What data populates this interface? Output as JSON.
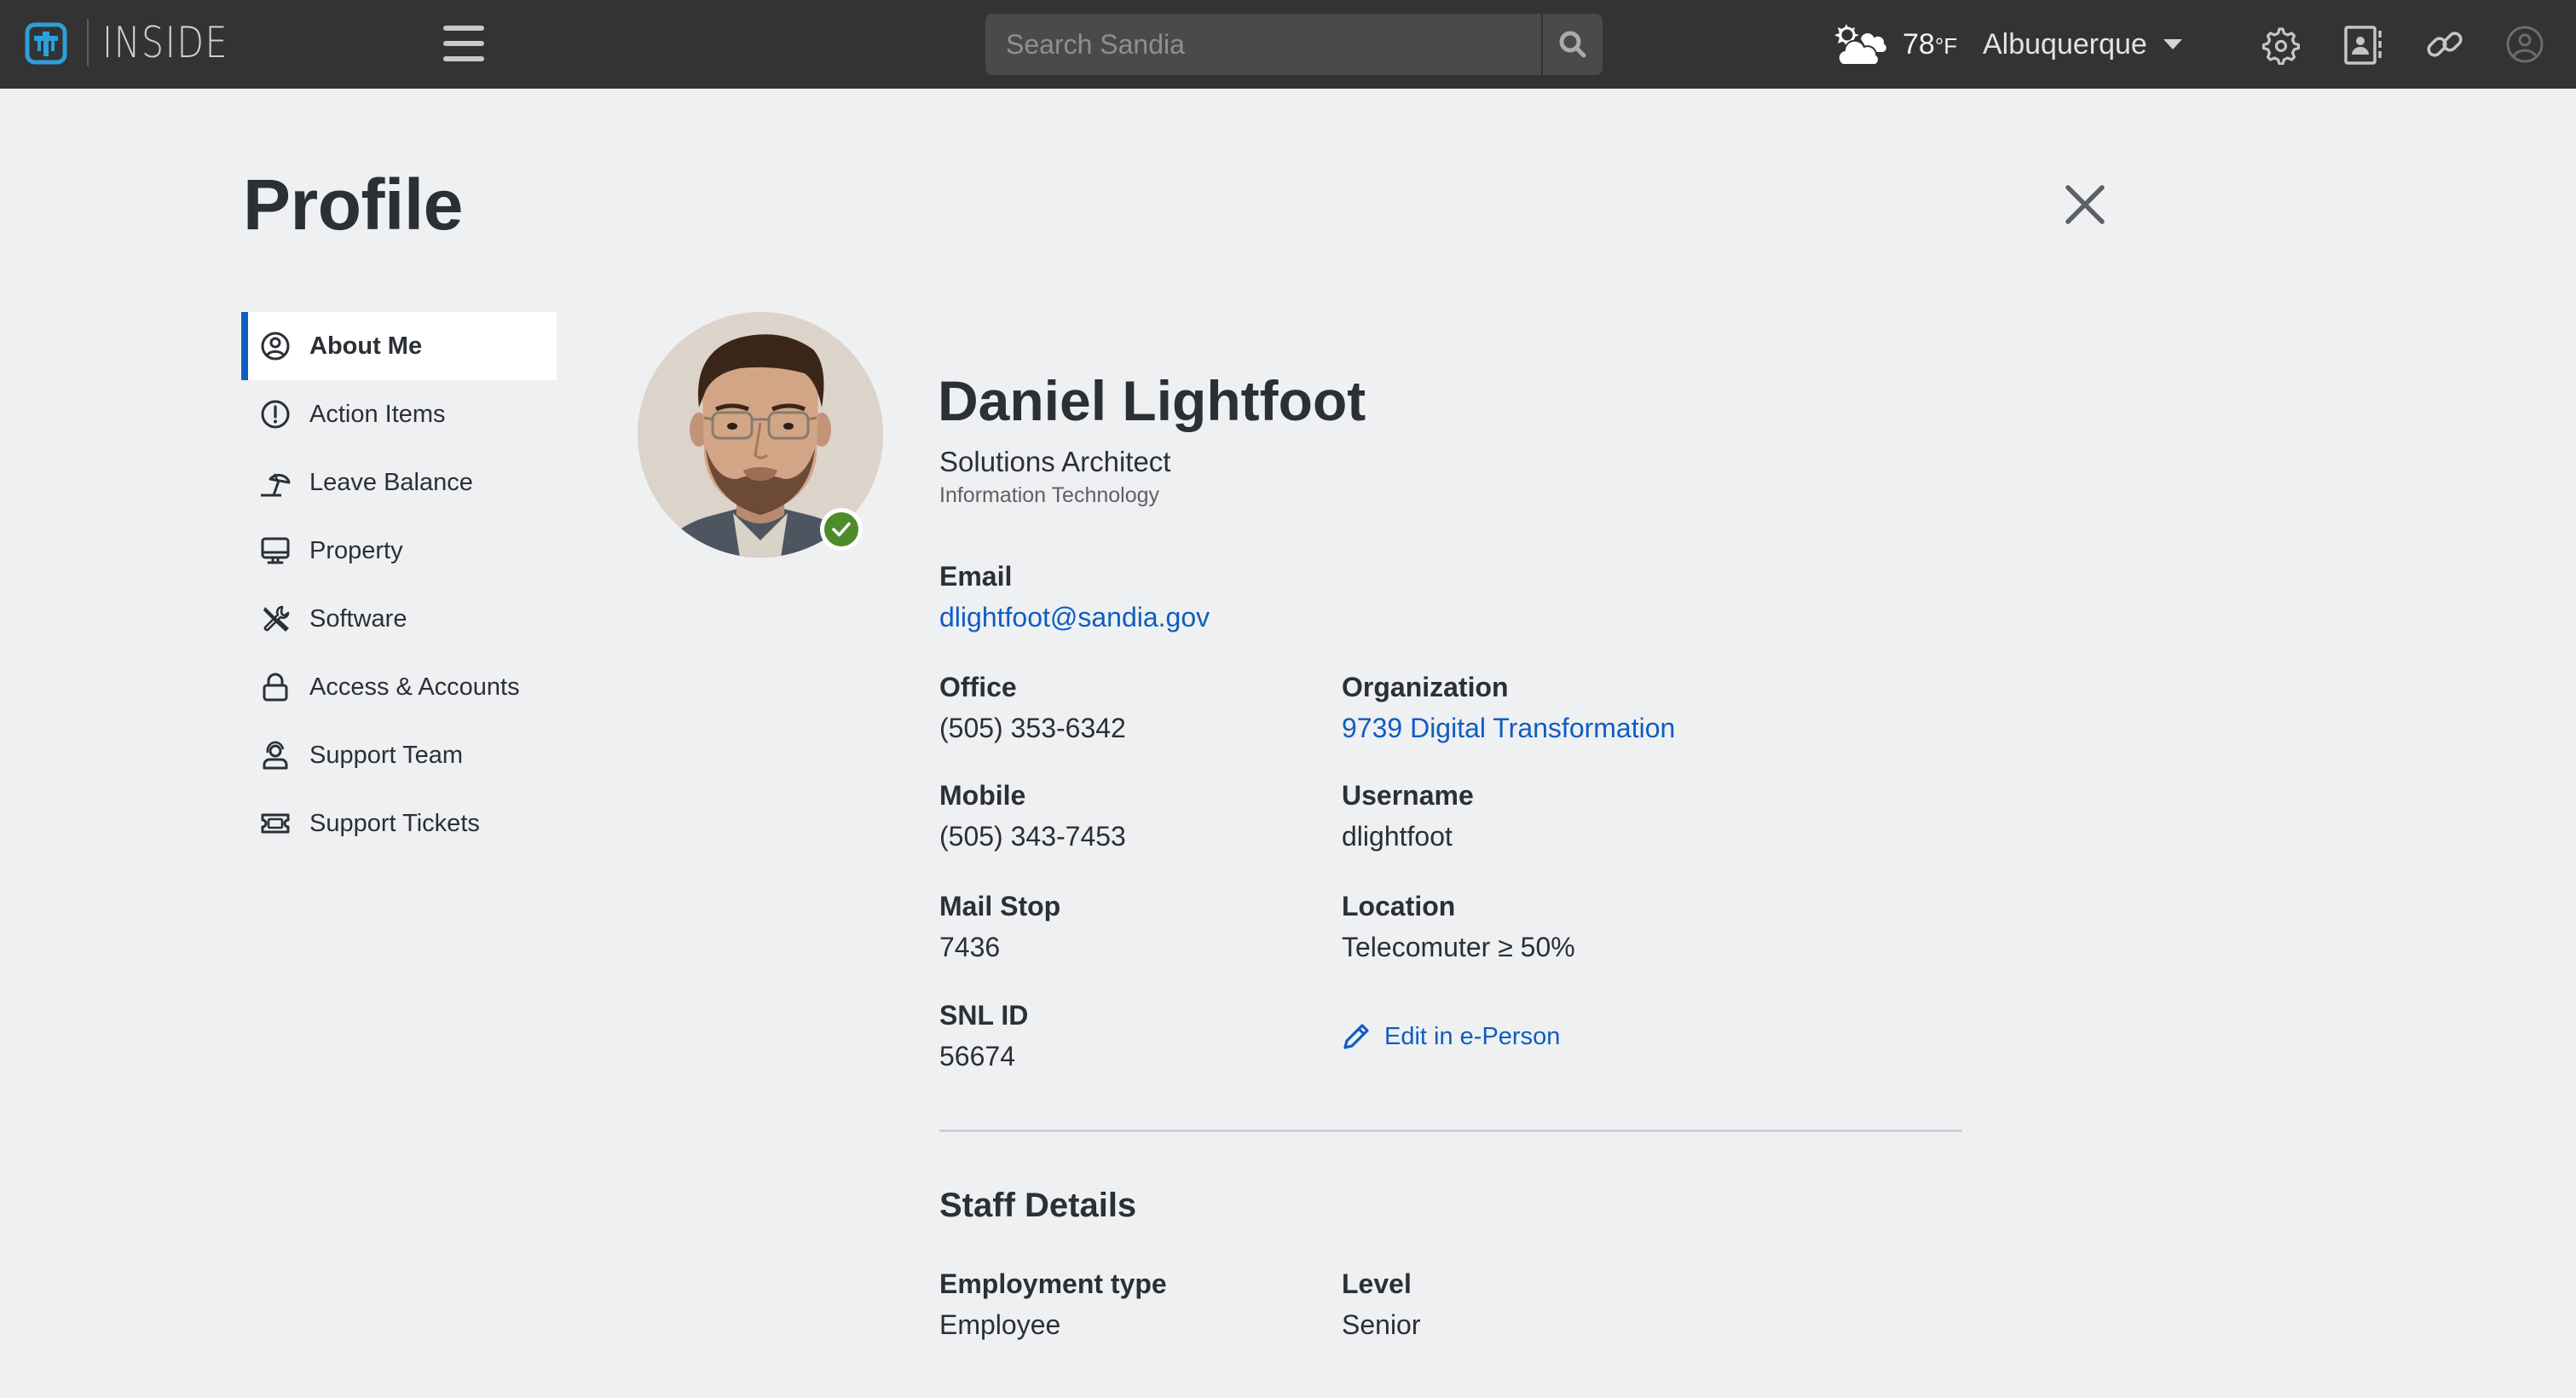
{
  "header": {
    "app_name": "INSIDE",
    "search_placeholder": "Search Sandia",
    "weather": {
      "icon": "partly-cloudy-icon",
      "temperature": "78",
      "unit": "°F"
    },
    "location": "Albuquerque",
    "icons": [
      "menu-icon",
      "search-icon",
      "settings-icon",
      "directory-icon",
      "links-icon",
      "account-icon"
    ]
  },
  "page": {
    "title": "Profile",
    "close_icon": "close-icon"
  },
  "sidebar": {
    "items": [
      {
        "label": "About Me",
        "icon": "user-circle-icon",
        "active": true
      },
      {
        "label": "Action Items",
        "icon": "alert-circle-icon",
        "active": false
      },
      {
        "label": "Leave Balance",
        "icon": "beach-umbrella-icon",
        "active": false
      },
      {
        "label": "Property",
        "icon": "monitor-icon",
        "active": false
      },
      {
        "label": "Software",
        "icon": "tools-icon",
        "active": false
      },
      {
        "label": "Access & Accounts",
        "icon": "lock-icon",
        "active": false
      },
      {
        "label": "Support Team",
        "icon": "headset-icon",
        "active": false
      },
      {
        "label": "Support Tickets",
        "icon": "ticket-icon",
        "active": false
      }
    ]
  },
  "profile": {
    "name": "Daniel Lightfoot",
    "job_title": "Solutions Architect",
    "department": "Information Technology",
    "status": "verified",
    "colors": {
      "link": "#0f5dc2",
      "status_badge": "#4c8c2b",
      "active_indicator": "#0f5dc2"
    },
    "fields": {
      "email": {
        "label": "Email",
        "value": "dlightfoot@sandia.gov"
      },
      "office": {
        "label": "Office",
        "value": "(505) 353-6342"
      },
      "organization": {
        "label": "Organization",
        "value": "9739 Digital Transformation"
      },
      "mobile": {
        "label": "Mobile",
        "value": "(505) 343-7453"
      },
      "username": {
        "label": "Username",
        "value": "dlightfoot"
      },
      "mail_stop": {
        "label": "Mail Stop",
        "value": "7436"
      },
      "location": {
        "label": "Location",
        "value": "Telecomuter ≥ 50%"
      },
      "snl_id": {
        "label": "SNL ID",
        "value": "56674"
      }
    },
    "edit_link": "Edit in e-Person"
  },
  "staff_details": {
    "title": "Staff Details",
    "fields": {
      "employment_type": {
        "label": "Employment type",
        "value": "Employee"
      },
      "level": {
        "label": "Level",
        "value": "Senior"
      }
    }
  }
}
